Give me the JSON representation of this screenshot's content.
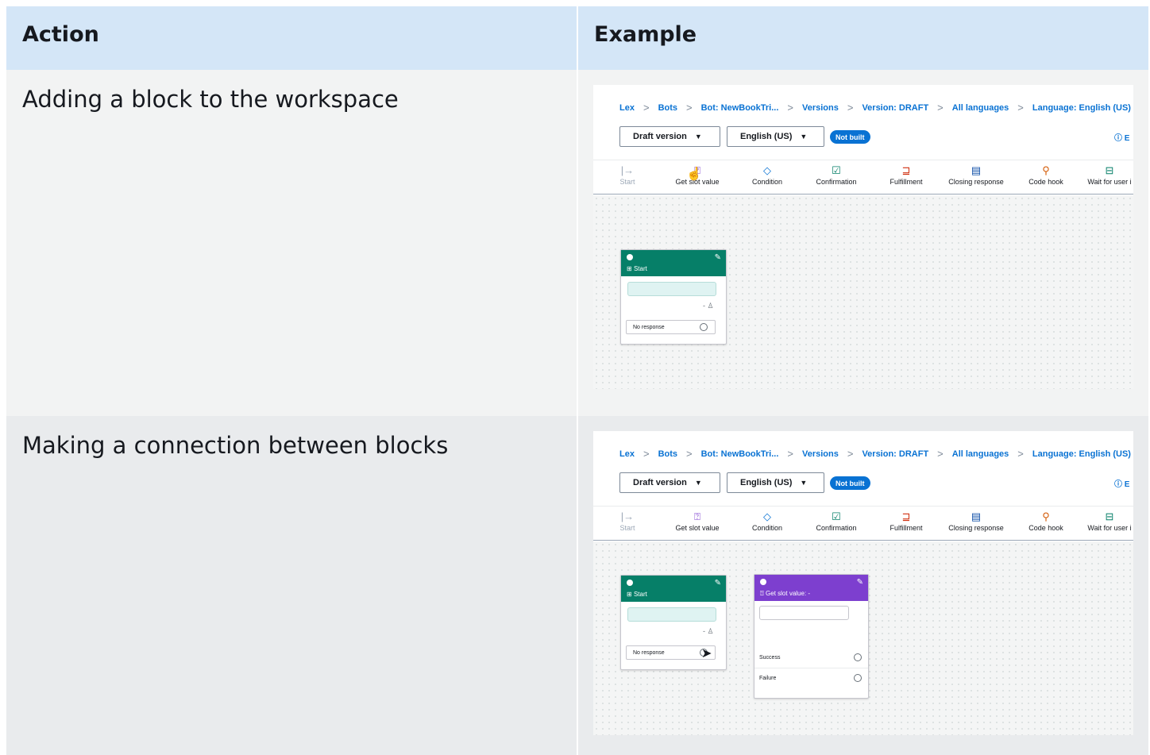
{
  "header": {
    "col1": "Action",
    "col2": "Example"
  },
  "rows": [
    {
      "action": "Adding a block to the workspace"
    },
    {
      "action": "Making a connection between blocks"
    }
  ],
  "console": {
    "breadcrumb": [
      "Lex",
      "Bots",
      "Bot: NewBookTri...",
      "Versions",
      "Version: DRAFT",
      "All languages",
      "Language: English (US)"
    ],
    "version_select": "Draft version",
    "language_select": "English (US)",
    "status_badge": "Not built",
    "info_text": "ⓘ E",
    "tools": [
      "Start",
      "Get slot value",
      "Condition",
      "Confirmation",
      "Fulfillment",
      "Closing response",
      "Code hook",
      "Wait for user i"
    ],
    "start_block": {
      "title": "Start",
      "response": "No response"
    },
    "slot_block": {
      "title": "Get slot value: -",
      "success": "Success",
      "failure": "Failure"
    }
  },
  "colors": {
    "header_bg": "#d4e6f7",
    "start_green": "#067f68",
    "slot_purple": "#7d3fcf",
    "link_blue": "#0972d3"
  }
}
